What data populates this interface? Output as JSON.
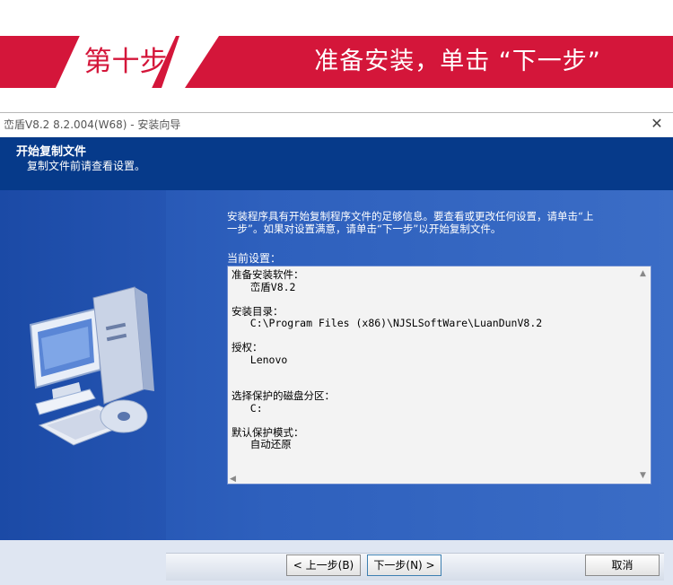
{
  "banner": {
    "step": "第十步",
    "title": "准备安装，单击 “下一步”"
  },
  "window": {
    "title": "峦盾V8.2 8.2.004(W68) - 安装向导",
    "close_icon": "close-icon"
  },
  "header": {
    "title": "开始复制文件",
    "subtitle": "复制文件前请查看设置。"
  },
  "main": {
    "intro_line1": "安装程序具有开始复制程序文件的足够信息。要查看或更改任何设置，请单击“上",
    "intro_line2": "一步”。如果对设置满意，请单击“下一步”以开始复制文件。",
    "current_settings_label": "当前设置：",
    "settings_text": "准备安装软件：\n   峦盾V8.2\n\n安装目录：\n   C:\\Program Files (x86)\\NJSLSoftWare\\LuanDunV8.2\n\n授权：\n   Lenovo\n\n\n选择保护的磁盘分区：\n   C:\n\n默认保护模式：\n   自动还原"
  },
  "footer": {
    "back_label": "< 上一步(B)",
    "next_label": "下一步(N) >",
    "cancel_label": "取消"
  },
  "colors": {
    "banner_red": "#d4163a",
    "header_blue": "#063a8a",
    "body_blue": "#2e60bd"
  }
}
